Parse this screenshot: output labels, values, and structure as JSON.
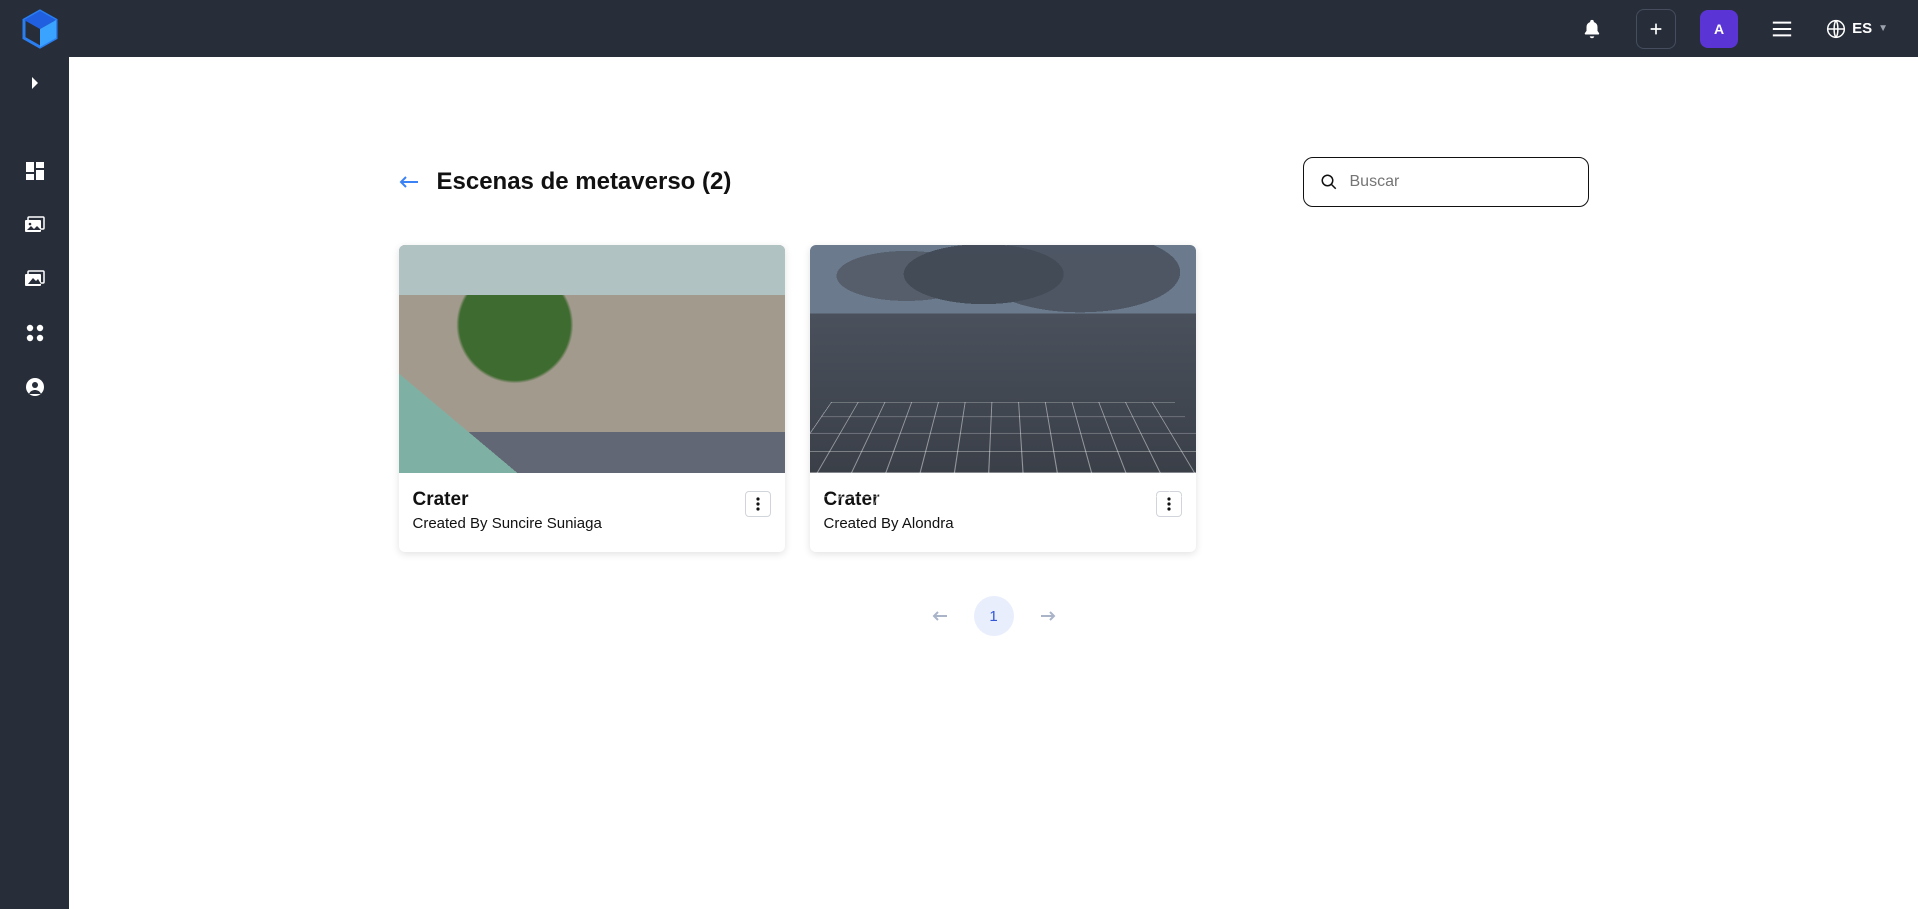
{
  "header": {
    "avatar_initial": "A",
    "language_code": "ES"
  },
  "page": {
    "title": "Escenas de metaverso (2)",
    "search_placeholder": "Buscar"
  },
  "cards": [
    {
      "title": "Crater",
      "subtitle": "Created By Suncire Suniaga"
    },
    {
      "title": "Crater",
      "subtitle": "Created By Alondra"
    }
  ],
  "pagination": {
    "current": "1"
  }
}
